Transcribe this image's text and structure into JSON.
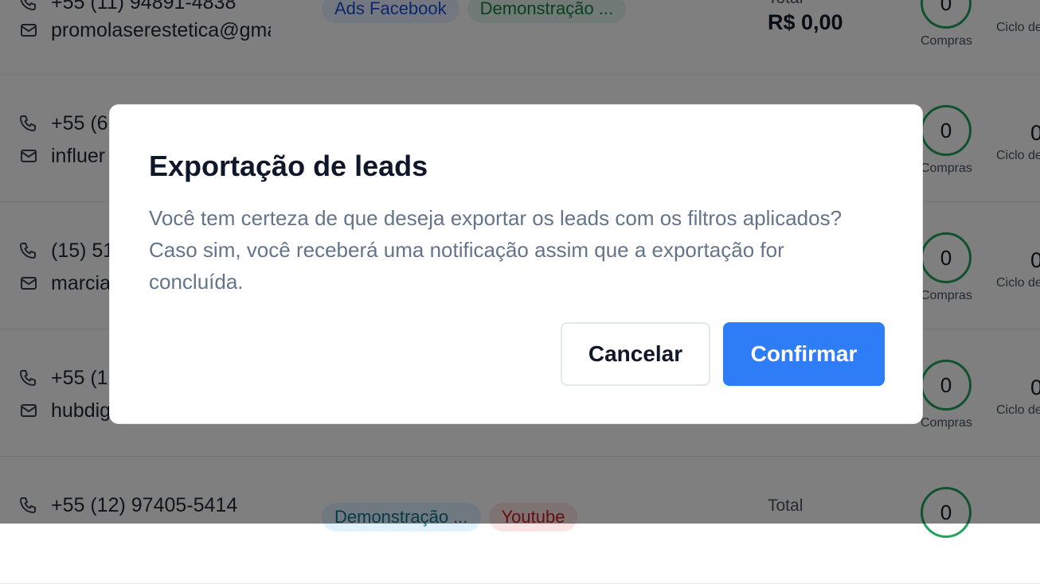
{
  "background": {
    "rows": [
      {
        "phone": "+55 (11) 94891-4838",
        "email": "promolaserestetica@gmail.com",
        "tags": [
          {
            "label": "Ads Facebook",
            "color": "blue"
          },
          {
            "label": "Demonstração ...",
            "color": "green"
          }
        ],
        "total_label": "Total",
        "total_value": "R$ 0,00",
        "purchases": "0",
        "purchases_label": "Compras",
        "cycle_value": "",
        "cycle_label": "Ciclo de"
      },
      {
        "phone": "+55 (6",
        "email": "influer",
        "purchases": "0",
        "purchases_label": "Compras",
        "cycle_value": "0",
        "cycle_label": "Ciclo de"
      },
      {
        "phone": "(15) 51",
        "email": "marcia",
        "purchases": "0",
        "purchases_label": "Compras",
        "cycle_value": "0",
        "cycle_label": "Ciclo de"
      },
      {
        "phone": "+55 (1",
        "email": "hubdig",
        "purchases": "0",
        "purchases_label": "Compras",
        "cycle_value": "0",
        "cycle_label": "Ciclo de"
      },
      {
        "phone": "+55 (12) 97405-5414",
        "tags": [
          {
            "label": "Demonstração ...",
            "color": "teal"
          },
          {
            "label": "Youtube",
            "color": "red"
          }
        ],
        "total_label": "Total",
        "purchases": "0"
      }
    ]
  },
  "modal": {
    "title": "Exportação de leads",
    "body": "Você tem certeza de que deseja exportar os leads com os filtros aplicados? Caso sim, você receberá uma notificação assim que a exportação for concluída.",
    "cancel_label": "Cancelar",
    "confirm_label": "Confirmar",
    "confirm_color": "#2e7cf6"
  },
  "icons": {
    "phone": "phone-icon",
    "email": "mail-icon"
  }
}
